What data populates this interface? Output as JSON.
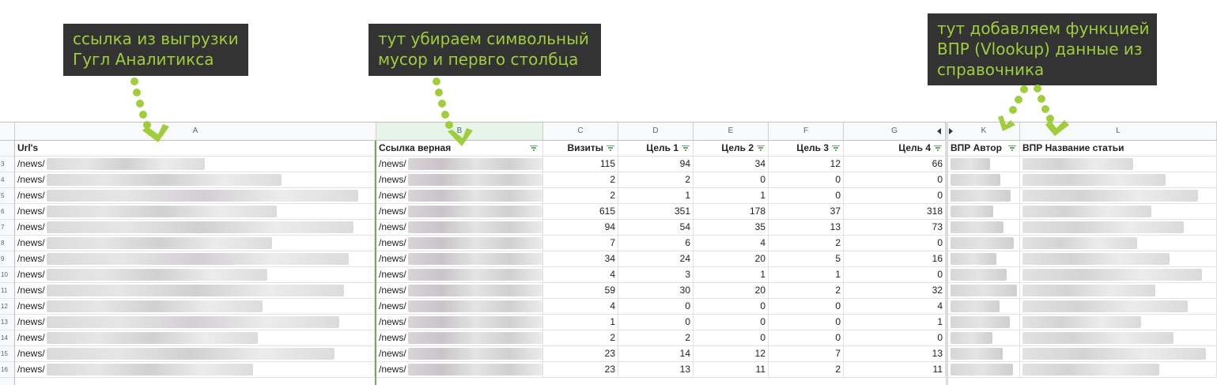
{
  "callouts": {
    "a_line1": "ссылка из выгрузки",
    "a_line2": "Гугл Аналитикса",
    "b_line1": "тут убираем символьный",
    "b_line2": "мусор и первго столбца",
    "kl_line1": "тут добавляем функцией",
    "kl_line2": "ВПР (Vlookup) данные из",
    "kl_line3": "справочника"
  },
  "colors": {
    "callout_bg": "#333333",
    "callout_text": "#9fcd3c",
    "arrow": "#9fcd3c"
  },
  "columns": [
    "A",
    "B",
    "C",
    "D",
    "E",
    "F",
    "G",
    "K",
    "L"
  ],
  "headers": {
    "a": "Url's",
    "b": "Ссылка верная",
    "c": "Визиты",
    "d": "Цель 1",
    "e": "Цель 2",
    "f": "Цель 3",
    "g": "Цель 4",
    "k": "ВПР Автор",
    "l": "ВПР Название статьи"
  },
  "url_prefix": "/news/",
  "rows": [
    {
      "num": "3",
      "c": "115",
      "d": "94",
      "e": "34",
      "f": "12",
      "g": "66"
    },
    {
      "num": "4",
      "c": "2",
      "d": "2",
      "e": "0",
      "f": "0",
      "g": "0"
    },
    {
      "num": "5",
      "c": "2",
      "d": "1",
      "e": "1",
      "f": "0",
      "g": "0"
    },
    {
      "num": "6",
      "c": "615",
      "d": "351",
      "e": "178",
      "f": "37",
      "g": "318"
    },
    {
      "num": "7",
      "c": "94",
      "d": "54",
      "e": "35",
      "f": "13",
      "g": "73"
    },
    {
      "num": "8",
      "c": "7",
      "d": "6",
      "e": "4",
      "f": "2",
      "g": "0"
    },
    {
      "num": "9",
      "c": "34",
      "d": "24",
      "e": "20",
      "f": "5",
      "g": "16"
    },
    {
      "num": "10",
      "c": "4",
      "d": "3",
      "e": "1",
      "f": "1",
      "g": "0"
    },
    {
      "num": "11",
      "c": "59",
      "d": "30",
      "e": "20",
      "f": "2",
      "g": "32"
    },
    {
      "num": "12",
      "c": "4",
      "d": "0",
      "e": "0",
      "f": "0",
      "g": "4"
    },
    {
      "num": "13",
      "c": "1",
      "d": "0",
      "e": "0",
      "f": "0",
      "g": "1"
    },
    {
      "num": "14",
      "c": "2",
      "d": "2",
      "e": "0",
      "f": "0",
      "g": "0"
    },
    {
      "num": "15",
      "c": "23",
      "d": "14",
      "e": "12",
      "f": "7",
      "g": "13"
    },
    {
      "num": "16",
      "c": "23",
      "d": "13",
      "e": "11",
      "f": "2",
      "g": "11"
    }
  ]
}
